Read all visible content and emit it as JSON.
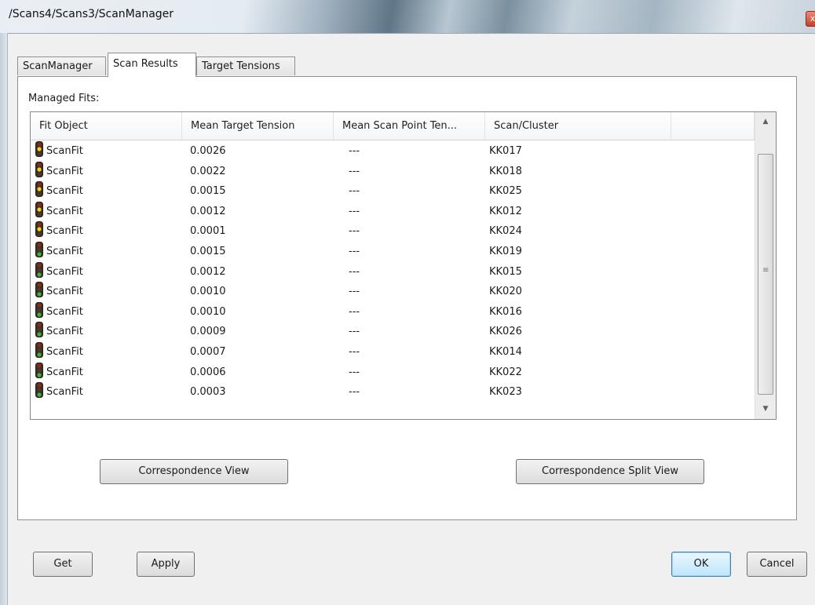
{
  "window": {
    "title": "/Scans4/Scans3/ScanManager",
    "close_glyph": "x"
  },
  "tabs": [
    {
      "label": "ScanManager",
      "active": false
    },
    {
      "label": "Scan Results",
      "active": true
    },
    {
      "label": "Target Tensions",
      "active": false
    }
  ],
  "managed_fits": {
    "label": "Managed Fits:",
    "columns": [
      "Fit Object",
      "Mean Target Tension",
      "Mean Scan Point Ten...",
      "Scan/Cluster"
    ],
    "rows": [
      {
        "fit": "ScanFit",
        "mean_target": "0.0026",
        "mean_scan": "---",
        "scan": "KK017",
        "icon": "traffic-light-icon",
        "light": "yellow"
      },
      {
        "fit": "ScanFit",
        "mean_target": "0.0022",
        "mean_scan": "---",
        "scan": "KK018",
        "icon": "traffic-light-icon",
        "light": "yellow"
      },
      {
        "fit": "ScanFit",
        "mean_target": "0.0015",
        "mean_scan": "---",
        "scan": "KK025",
        "icon": "traffic-light-icon",
        "light": "yellow"
      },
      {
        "fit": "ScanFit",
        "mean_target": "0.0012",
        "mean_scan": "---",
        "scan": "KK012",
        "icon": "traffic-light-icon",
        "light": "yellow"
      },
      {
        "fit": "ScanFit",
        "mean_target": "0.0001",
        "mean_scan": "---",
        "scan": "KK024",
        "icon": "traffic-light-icon",
        "light": "yellow"
      },
      {
        "fit": "ScanFit",
        "mean_target": "0.0015",
        "mean_scan": "---",
        "scan": "KK019",
        "icon": "traffic-light-icon",
        "light": "green"
      },
      {
        "fit": "ScanFit",
        "mean_target": "0.0012",
        "mean_scan": "---",
        "scan": "KK015",
        "icon": "traffic-light-icon",
        "light": "green"
      },
      {
        "fit": "ScanFit",
        "mean_target": "0.0010",
        "mean_scan": "---",
        "scan": "KK020",
        "icon": "traffic-light-icon",
        "light": "green"
      },
      {
        "fit": "ScanFit",
        "mean_target": "0.0010",
        "mean_scan": "---",
        "scan": "KK016",
        "icon": "traffic-light-icon",
        "light": "green"
      },
      {
        "fit": "ScanFit",
        "mean_target": "0.0009",
        "mean_scan": "---",
        "scan": "KK026",
        "icon": "traffic-light-icon",
        "light": "green"
      },
      {
        "fit": "ScanFit",
        "mean_target": "0.0007",
        "mean_scan": "---",
        "scan": "KK014",
        "icon": "traffic-light-icon",
        "light": "green"
      },
      {
        "fit": "ScanFit",
        "mean_target": "0.0006",
        "mean_scan": "---",
        "scan": "KK022",
        "icon": "traffic-light-icon",
        "light": "green"
      },
      {
        "fit": "ScanFit",
        "mean_target": "0.0003",
        "mean_scan": "---",
        "scan": "KK023",
        "icon": "traffic-light-icon",
        "light": "green"
      }
    ]
  },
  "buttons": {
    "correspondence_view": "Correspondence View",
    "correspondence_split_view": "Correspondence Split View",
    "get": "Get",
    "apply": "Apply",
    "ok": "OK",
    "cancel": "Cancel"
  },
  "colors": {
    "light_red": "#8b2a1a",
    "light_yellow": "#f2d21b",
    "light_green": "#37b540",
    "light_off": "#4a3a2a"
  }
}
